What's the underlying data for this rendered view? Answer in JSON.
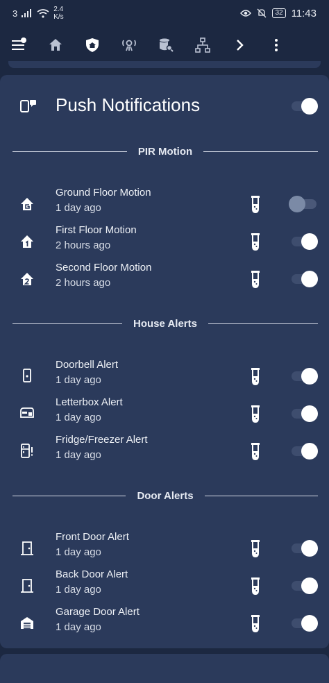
{
  "statusbar": {
    "carrier": "3",
    "speed_value": "2.4",
    "speed_unit": "K/s",
    "battery": "32",
    "time": "11:43"
  },
  "toolbar": {
    "icons": [
      "menu-icon",
      "home-icon",
      "security-icon",
      "motion-icon",
      "storage-icon",
      "network-icon",
      "chevron-right-icon",
      "more-vert-icon"
    ],
    "active": "security-icon"
  },
  "push": {
    "title": "Push Notifications",
    "enabled": true
  },
  "sections": [
    {
      "title": "PIR Motion",
      "items": [
        {
          "name": "Ground Floor Motion",
          "sub": "1 day ago",
          "icon": "home-floor-g-icon",
          "on": false
        },
        {
          "name": "First Floor Motion",
          "sub": "2 hours ago",
          "icon": "home-floor-1-icon",
          "on": true
        },
        {
          "name": "Second Floor Motion",
          "sub": "2 hours ago",
          "icon": "home-floor-2-icon",
          "on": true
        }
      ]
    },
    {
      "title": "House Alerts",
      "items": [
        {
          "name": "Doorbell Alert",
          "sub": "1 day ago",
          "icon": "doorbell-icon",
          "on": true
        },
        {
          "name": "Letterbox Alert",
          "sub": "1 day ago",
          "icon": "letterbox-icon",
          "on": true
        },
        {
          "name": "Fridge/Freezer Alert",
          "sub": "1 day ago",
          "icon": "fridge-alert-icon",
          "on": true
        }
      ]
    },
    {
      "title": "Door Alerts",
      "items": [
        {
          "name": "Front Door Alert",
          "sub": "1 day ago",
          "icon": "door-icon",
          "on": true
        },
        {
          "name": "Back Door Alert",
          "sub": "1 day ago",
          "icon": "door-icon",
          "on": true
        },
        {
          "name": "Garage Door Alert",
          "sub": "1 day ago",
          "icon": "garage-icon",
          "on": true
        }
      ]
    }
  ]
}
